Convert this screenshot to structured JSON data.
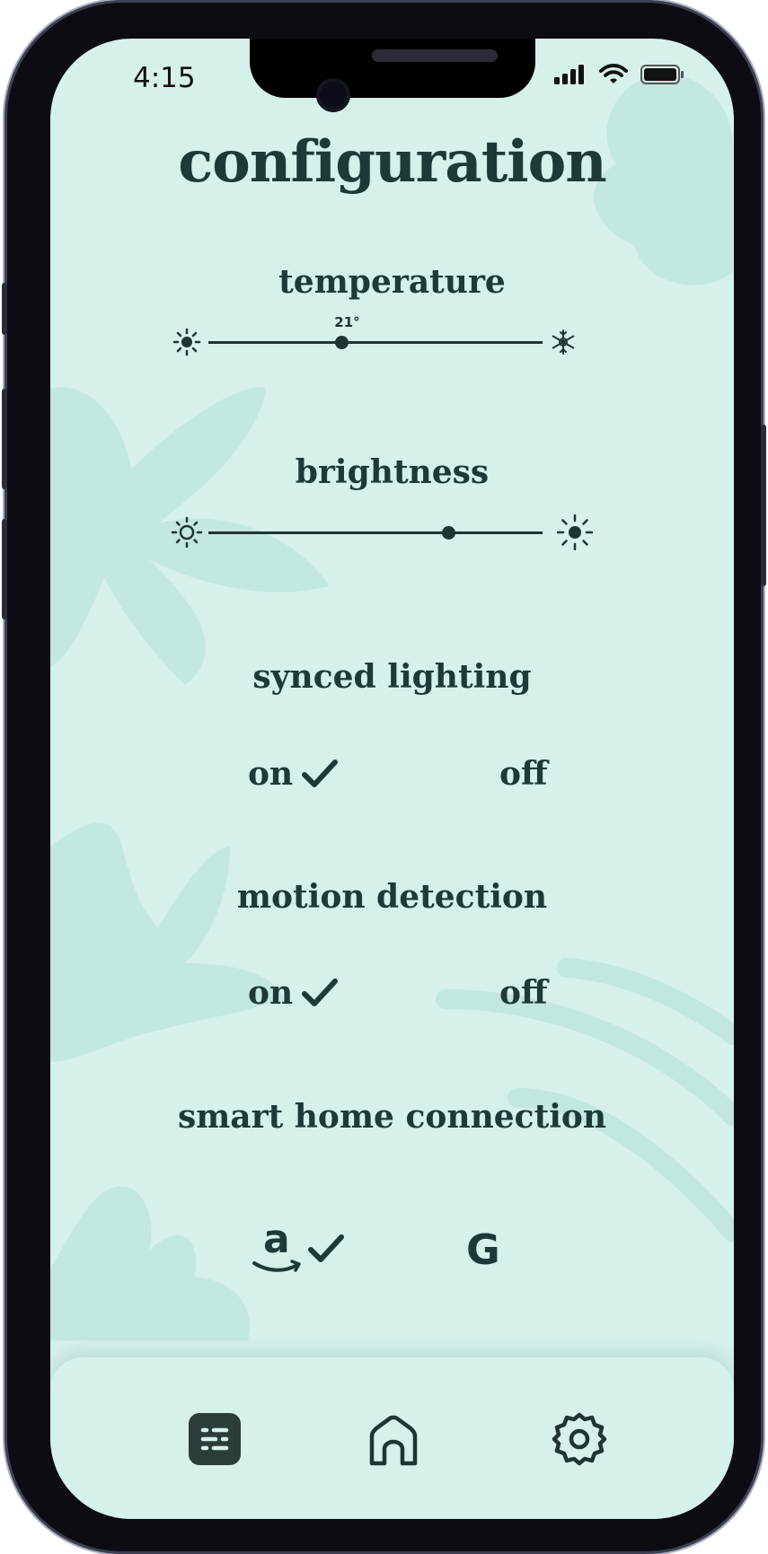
{
  "status_bar": {
    "time": "4:15"
  },
  "page": {
    "title": "configuration"
  },
  "temperature": {
    "label": "temperature",
    "value": 21,
    "value_text": "21°",
    "position": 0.4
  },
  "brightness": {
    "label": "brightness",
    "position": 0.72
  },
  "synced_lighting": {
    "label": "synced lighting",
    "on": "on",
    "off": "off",
    "selected": "on"
  },
  "motion_detection": {
    "label": "motion detection",
    "on": "on",
    "off": "off",
    "selected": "on"
  },
  "smart_home": {
    "label": "smart home connection",
    "amazon_glyph": "a",
    "google_glyph": "G",
    "selected": "amazon"
  },
  "nav": {
    "items": [
      "settings-list-icon",
      "home-icon",
      "gear-icon"
    ],
    "active": 0
  },
  "colors": {
    "background": "#d6f0ec",
    "text": "#1e3a38",
    "accent": "#1f3533",
    "leaf": "#b5e0d9"
  }
}
